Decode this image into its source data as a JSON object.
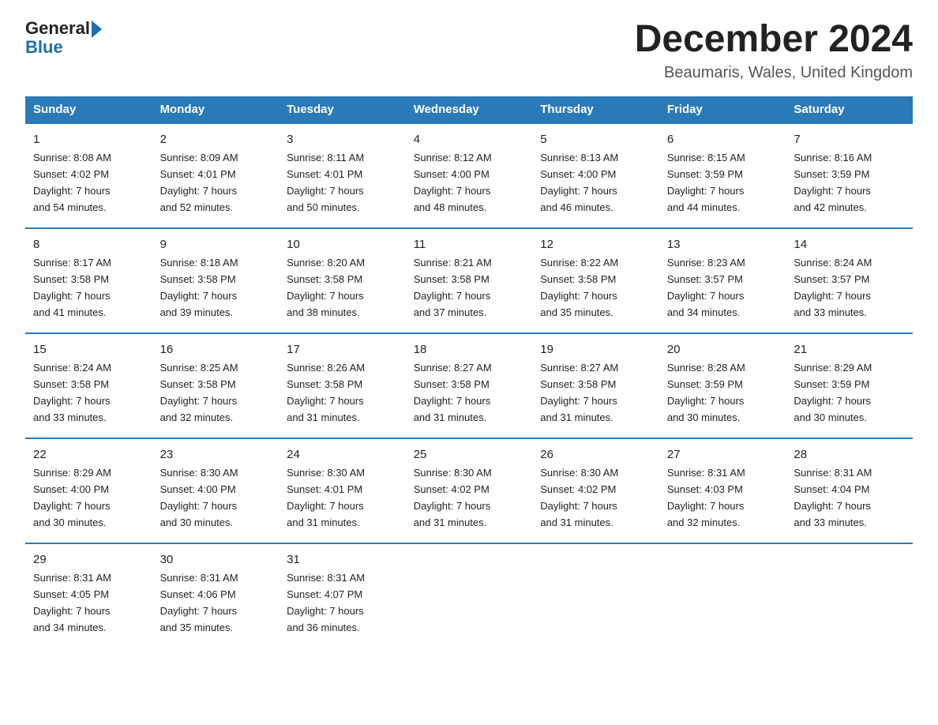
{
  "header": {
    "logo_general": "General",
    "logo_blue": "Blue",
    "month_title": "December 2024",
    "location": "Beaumaris, Wales, United Kingdom"
  },
  "days_of_week": [
    "Sunday",
    "Monday",
    "Tuesday",
    "Wednesday",
    "Thursday",
    "Friday",
    "Saturday"
  ],
  "weeks": [
    [
      {
        "day": "1",
        "sunrise": "8:08 AM",
        "sunset": "4:02 PM",
        "daylight": "7 hours and 54 minutes."
      },
      {
        "day": "2",
        "sunrise": "8:09 AM",
        "sunset": "4:01 PM",
        "daylight": "7 hours and 52 minutes."
      },
      {
        "day": "3",
        "sunrise": "8:11 AM",
        "sunset": "4:01 PM",
        "daylight": "7 hours and 50 minutes."
      },
      {
        "day": "4",
        "sunrise": "8:12 AM",
        "sunset": "4:00 PM",
        "daylight": "7 hours and 48 minutes."
      },
      {
        "day": "5",
        "sunrise": "8:13 AM",
        "sunset": "4:00 PM",
        "daylight": "7 hours and 46 minutes."
      },
      {
        "day": "6",
        "sunrise": "8:15 AM",
        "sunset": "3:59 PM",
        "daylight": "7 hours and 44 minutes."
      },
      {
        "day": "7",
        "sunrise": "8:16 AM",
        "sunset": "3:59 PM",
        "daylight": "7 hours and 42 minutes."
      }
    ],
    [
      {
        "day": "8",
        "sunrise": "8:17 AM",
        "sunset": "3:58 PM",
        "daylight": "7 hours and 41 minutes."
      },
      {
        "day": "9",
        "sunrise": "8:18 AM",
        "sunset": "3:58 PM",
        "daylight": "7 hours and 39 minutes."
      },
      {
        "day": "10",
        "sunrise": "8:20 AM",
        "sunset": "3:58 PM",
        "daylight": "7 hours and 38 minutes."
      },
      {
        "day": "11",
        "sunrise": "8:21 AM",
        "sunset": "3:58 PM",
        "daylight": "7 hours and 37 minutes."
      },
      {
        "day": "12",
        "sunrise": "8:22 AM",
        "sunset": "3:58 PM",
        "daylight": "7 hours and 35 minutes."
      },
      {
        "day": "13",
        "sunrise": "8:23 AM",
        "sunset": "3:57 PM",
        "daylight": "7 hours and 34 minutes."
      },
      {
        "day": "14",
        "sunrise": "8:24 AM",
        "sunset": "3:57 PM",
        "daylight": "7 hours and 33 minutes."
      }
    ],
    [
      {
        "day": "15",
        "sunrise": "8:24 AM",
        "sunset": "3:58 PM",
        "daylight": "7 hours and 33 minutes."
      },
      {
        "day": "16",
        "sunrise": "8:25 AM",
        "sunset": "3:58 PM",
        "daylight": "7 hours and 32 minutes."
      },
      {
        "day": "17",
        "sunrise": "8:26 AM",
        "sunset": "3:58 PM",
        "daylight": "7 hours and 31 minutes."
      },
      {
        "day": "18",
        "sunrise": "8:27 AM",
        "sunset": "3:58 PM",
        "daylight": "7 hours and 31 minutes."
      },
      {
        "day": "19",
        "sunrise": "8:27 AM",
        "sunset": "3:58 PM",
        "daylight": "7 hours and 31 minutes."
      },
      {
        "day": "20",
        "sunrise": "8:28 AM",
        "sunset": "3:59 PM",
        "daylight": "7 hours and 30 minutes."
      },
      {
        "day": "21",
        "sunrise": "8:29 AM",
        "sunset": "3:59 PM",
        "daylight": "7 hours and 30 minutes."
      }
    ],
    [
      {
        "day": "22",
        "sunrise": "8:29 AM",
        "sunset": "4:00 PM",
        "daylight": "7 hours and 30 minutes."
      },
      {
        "day": "23",
        "sunrise": "8:30 AM",
        "sunset": "4:00 PM",
        "daylight": "7 hours and 30 minutes."
      },
      {
        "day": "24",
        "sunrise": "8:30 AM",
        "sunset": "4:01 PM",
        "daylight": "7 hours and 31 minutes."
      },
      {
        "day": "25",
        "sunrise": "8:30 AM",
        "sunset": "4:02 PM",
        "daylight": "7 hours and 31 minutes."
      },
      {
        "day": "26",
        "sunrise": "8:30 AM",
        "sunset": "4:02 PM",
        "daylight": "7 hours and 31 minutes."
      },
      {
        "day": "27",
        "sunrise": "8:31 AM",
        "sunset": "4:03 PM",
        "daylight": "7 hours and 32 minutes."
      },
      {
        "day": "28",
        "sunrise": "8:31 AM",
        "sunset": "4:04 PM",
        "daylight": "7 hours and 33 minutes."
      }
    ],
    [
      {
        "day": "29",
        "sunrise": "8:31 AM",
        "sunset": "4:05 PM",
        "daylight": "7 hours and 34 minutes."
      },
      {
        "day": "30",
        "sunrise": "8:31 AM",
        "sunset": "4:06 PM",
        "daylight": "7 hours and 35 minutes."
      },
      {
        "day": "31",
        "sunrise": "8:31 AM",
        "sunset": "4:07 PM",
        "daylight": "7 hours and 36 minutes."
      },
      null,
      null,
      null,
      null
    ]
  ],
  "labels": {
    "sunrise": "Sunrise:",
    "sunset": "Sunset:",
    "daylight": "Daylight:"
  }
}
